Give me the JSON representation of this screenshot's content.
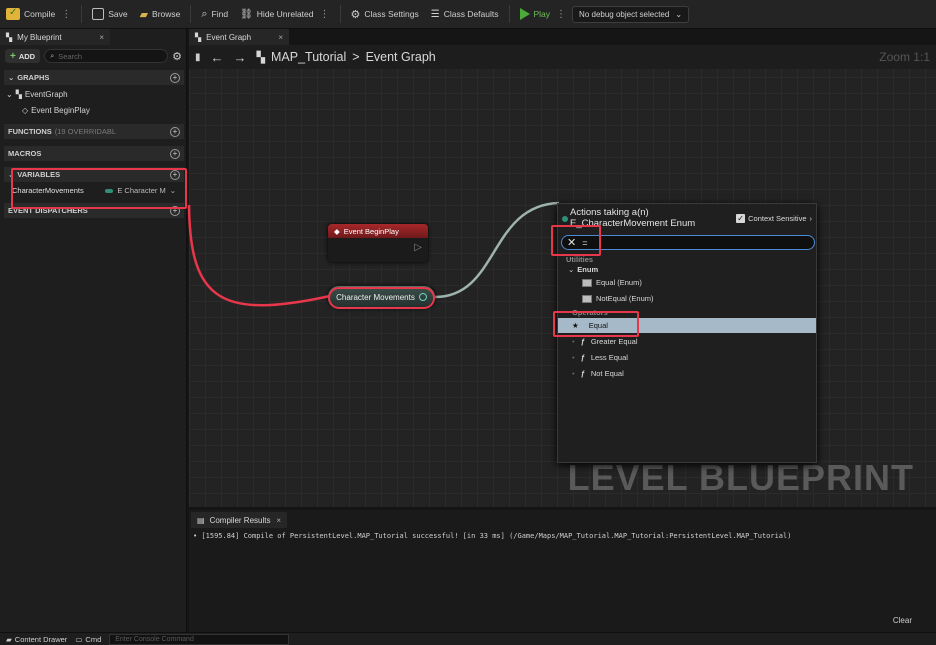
{
  "toolbar": {
    "compile": "Compile",
    "save": "Save",
    "browse": "Browse",
    "find": "Find",
    "hide_unrelated": "Hide Unrelated",
    "class_settings": "Class Settings",
    "class_defaults": "Class Defaults",
    "play": "Play",
    "debug_object": "No debug object selected"
  },
  "left_panel": {
    "tab": "My Blueprint",
    "add": "ADD",
    "search_placeholder": "Search",
    "graphs": "GRAPHS",
    "event_graph": "EventGraph",
    "event_begin_play": "Event BeginPlay",
    "functions": "FUNCTIONS",
    "functions_sub": "(19 OVERRIDABL",
    "macros": "MACROS",
    "variables": "VARIABLES",
    "var_name": "CharacterMovements",
    "var_type": "E Character M",
    "event_dispatchers": "EVENT DISPATCHERS"
  },
  "graph": {
    "tab": "Event Graph",
    "breadcrumb_root": "MAP_Tutorial",
    "breadcrumb_sep": ">",
    "breadcrumb_current": "Event Graph",
    "zoom": "Zoom 1:1",
    "watermark": "LEVEL BLUEPRINT",
    "node_event": "Event BeginPlay",
    "node_var": "Character Movements"
  },
  "menu": {
    "title_line1": "Actions taking a(n)",
    "title_line2": "E_CharacterMovement Enum",
    "context_sensitive": "Context Sensitive",
    "search_value": "=",
    "items": [
      {
        "label": "Utilities",
        "kind": "category"
      },
      {
        "label": "Enum",
        "kind": "category"
      },
      {
        "label": "Equal (Enum)",
        "kind": "table"
      },
      {
        "label": "NotEqual (Enum)",
        "kind": "table"
      },
      {
        "label": "Operators",
        "kind": "category"
      },
      {
        "label": "Equal",
        "kind": "selected"
      },
      {
        "label": "Greater Equal",
        "kind": "function"
      },
      {
        "label": "Less Equal",
        "kind": "function"
      },
      {
        "label": "Not Equal",
        "kind": "function"
      }
    ]
  },
  "results": {
    "tab": "Compiler Results",
    "line": "• [1595.84] Compile of PersistentLevel.MAP_Tutorial successful! [in 33 ms] (/Game/Maps/MAP_Tutorial.MAP_Tutorial:PersistentLevel.MAP_Tutorial)",
    "clear": "Clear"
  },
  "bottombar": {
    "content_drawer": "Content Drawer",
    "cmd": "Cmd",
    "console_placeholder": "Enter Console Command"
  },
  "colors": {
    "highlight_box": "#e8364a",
    "selection": "#a6b9c8",
    "event_header": "#a7282a"
  }
}
